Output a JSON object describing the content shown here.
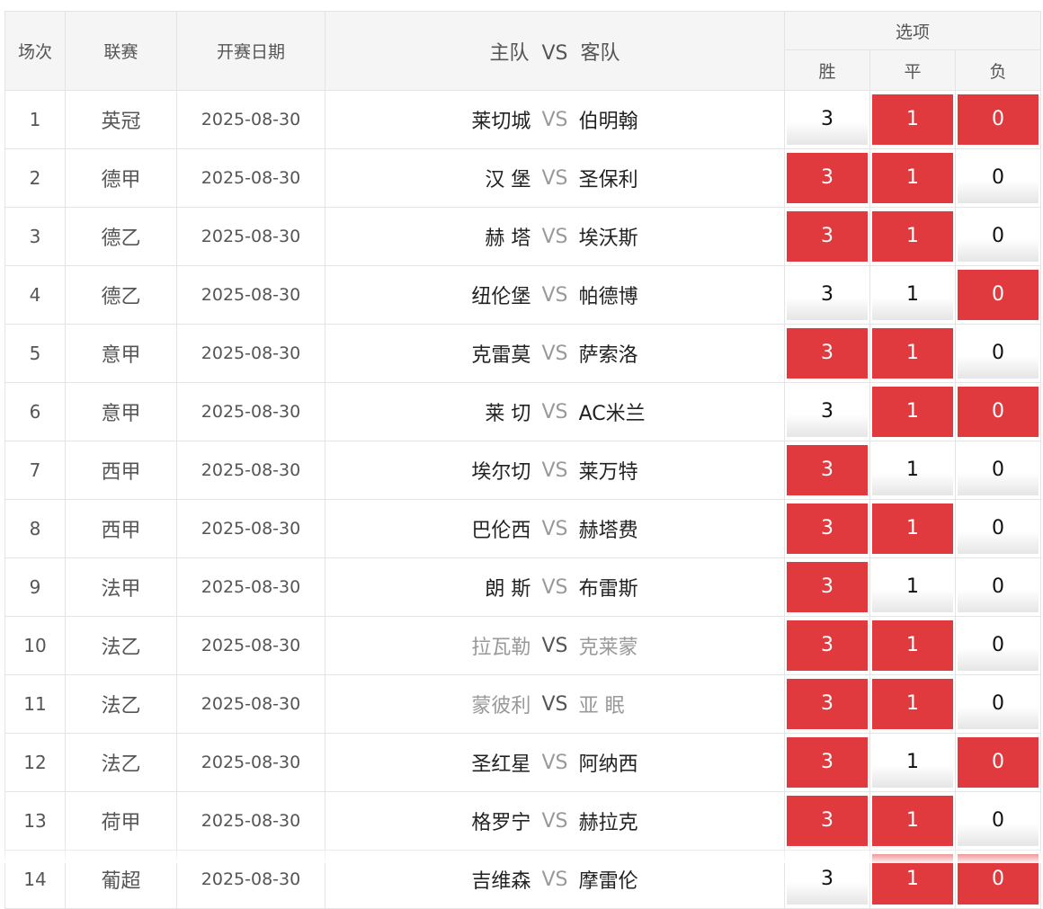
{
  "header": {
    "round": "场次",
    "league": "联赛",
    "date": "开赛日期",
    "home_team": "主队",
    "vs": "VS",
    "away_team": "客队",
    "options": "选项",
    "win": "胜",
    "draw": "平",
    "loss": "负"
  },
  "colors": {
    "selected": "#e03a3e",
    "header_bg": "#f5f5f5"
  },
  "matches": [
    {
      "no": "1",
      "league": "英冠",
      "date": "2025-08-30",
      "home": "莱切城",
      "away": "伯明翰",
      "dim": false,
      "win": "3",
      "draw": "1",
      "loss": "0",
      "sel": [
        false,
        true,
        true
      ]
    },
    {
      "no": "2",
      "league": "德甲",
      "date": "2025-08-30",
      "home": "汉 堡",
      "away": "圣保利",
      "dim": false,
      "win": "3",
      "draw": "1",
      "loss": "0",
      "sel": [
        true,
        true,
        false
      ]
    },
    {
      "no": "3",
      "league": "德乙",
      "date": "2025-08-30",
      "home": "赫 塔",
      "away": "埃沃斯",
      "dim": false,
      "win": "3",
      "draw": "1",
      "loss": "0",
      "sel": [
        true,
        true,
        false
      ]
    },
    {
      "no": "4",
      "league": "德乙",
      "date": "2025-08-30",
      "home": "纽伦堡",
      "away": "帕德博",
      "dim": false,
      "win": "3",
      "draw": "1",
      "loss": "0",
      "sel": [
        false,
        false,
        true
      ]
    },
    {
      "no": "5",
      "league": "意甲",
      "date": "2025-08-30",
      "home": "克雷莫",
      "away": "萨索洛",
      "dim": false,
      "win": "3",
      "draw": "1",
      "loss": "0",
      "sel": [
        true,
        true,
        false
      ]
    },
    {
      "no": "6",
      "league": "意甲",
      "date": "2025-08-30",
      "home": "莱 切",
      "away": "AC米兰",
      "dim": false,
      "win": "3",
      "draw": "1",
      "loss": "0",
      "sel": [
        false,
        true,
        true
      ]
    },
    {
      "no": "7",
      "league": "西甲",
      "date": "2025-08-30",
      "home": "埃尔切",
      "away": "莱万特",
      "dim": false,
      "win": "3",
      "draw": "1",
      "loss": "0",
      "sel": [
        true,
        false,
        false
      ]
    },
    {
      "no": "8",
      "league": "西甲",
      "date": "2025-08-30",
      "home": "巴伦西",
      "away": "赫塔费",
      "dim": false,
      "win": "3",
      "draw": "1",
      "loss": "0",
      "sel": [
        true,
        true,
        false
      ]
    },
    {
      "no": "9",
      "league": "法甲",
      "date": "2025-08-30",
      "home": "朗 斯",
      "away": "布雷斯",
      "dim": false,
      "win": "3",
      "draw": "1",
      "loss": "0",
      "sel": [
        true,
        false,
        false
      ]
    },
    {
      "no": "10",
      "league": "法乙",
      "date": "2025-08-30",
      "home": "拉瓦勒",
      "away": "克莱蒙",
      "dim": true,
      "win": "3",
      "draw": "1",
      "loss": "0",
      "sel": [
        true,
        true,
        false
      ]
    },
    {
      "no": "11",
      "league": "法乙",
      "date": "2025-08-30",
      "home": "蒙彼利",
      "away": "亚 眠",
      "dim": true,
      "win": "3",
      "draw": "1",
      "loss": "0",
      "sel": [
        true,
        true,
        false
      ]
    },
    {
      "no": "12",
      "league": "法乙",
      "date": "2025-08-30",
      "home": "圣红星",
      "away": "阿纳西",
      "dim": false,
      "win": "3",
      "draw": "1",
      "loss": "0",
      "sel": [
        true,
        false,
        true
      ]
    },
    {
      "no": "13",
      "league": "荷甲",
      "date": "2025-08-30",
      "home": "格罗宁",
      "away": "赫拉克",
      "dim": false,
      "win": "3",
      "draw": "1",
      "loss": "0",
      "sel": [
        true,
        true,
        false
      ]
    },
    {
      "no": "14",
      "league": "葡超",
      "date": "2025-08-30",
      "home": "吉维森",
      "away": "摩雷伦",
      "dim": false,
      "win": "3",
      "draw": "1",
      "loss": "0",
      "sel": [
        false,
        true,
        true
      ]
    }
  ]
}
